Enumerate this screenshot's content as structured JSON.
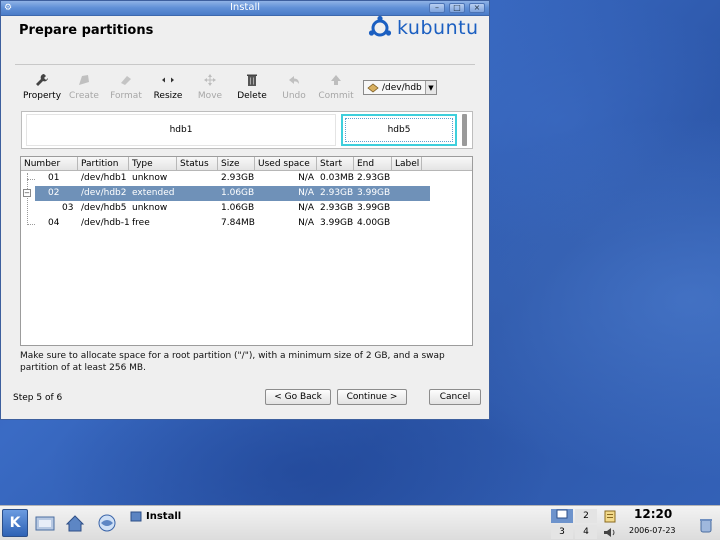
{
  "window": {
    "title": "Install",
    "page_title": "Prepare partitions",
    "logo_text": "kubuntu"
  },
  "toolbar": {
    "items": [
      {
        "label": "Property",
        "icon": "wrench-icon",
        "enabled": true
      },
      {
        "label": "Create",
        "icon": "create-icon",
        "enabled": false
      },
      {
        "label": "Format",
        "icon": "eraser-icon",
        "enabled": false
      },
      {
        "label": "Resize",
        "icon": "resize-arrows-icon",
        "enabled": true
      },
      {
        "label": "Move",
        "icon": "move-arrows-icon",
        "enabled": false
      },
      {
        "label": "Delete",
        "icon": "trash-icon",
        "enabled": true
      },
      {
        "label": "Undo",
        "icon": "undo-icon",
        "enabled": false
      },
      {
        "label": "Commit",
        "icon": "commit-icon",
        "enabled": false
      }
    ],
    "device": "/dev/hdb"
  },
  "partition_bar": {
    "segments": [
      {
        "label": "hdb1"
      },
      {
        "label": "hdb5",
        "selected": true
      }
    ]
  },
  "table": {
    "columns": [
      "Number",
      "Partition",
      "Type",
      "Status",
      "Size",
      "Used space",
      "Start",
      "End",
      "Label"
    ],
    "rows": [
      {
        "number": "01",
        "partition": "/dev/hdb1",
        "type": "unknow",
        "status": "",
        "size": "2.93GB",
        "used": "N/A",
        "start": "0.03MB",
        "end": "2.93GB",
        "label": "",
        "selected": false
      },
      {
        "number": "02",
        "partition": "/dev/hdb2",
        "type": "extended",
        "status": "",
        "size": "1.06GB",
        "used": "N/A",
        "start": "2.93GB",
        "end": "3.99GB",
        "label": "",
        "selected": true
      },
      {
        "number": "03",
        "partition": "/dev/hdb5",
        "type": "unknow",
        "status": "",
        "size": "1.06GB",
        "used": "N/A",
        "start": "2.93GB",
        "end": "3.99GB",
        "label": "",
        "selected": false
      },
      {
        "number": "04",
        "partition": "/dev/hdb-1",
        "type": "free",
        "status": "",
        "size": "7.84MB",
        "used": "N/A",
        "start": "3.99GB",
        "end": "4.00GB",
        "label": "",
        "selected": false
      }
    ]
  },
  "note": "Make sure to allocate space for a root partition (\"/\"), with a minimum size of 2 GB, and a swap partition of at least 256 MB.",
  "footer": {
    "step": "Step 5 of 6",
    "back": "< Go Back",
    "continue": "Continue >",
    "cancel": "Cancel"
  },
  "taskbar": {
    "task_label": "Install",
    "pager": [
      "2",
      "3",
      "4"
    ],
    "clock_time": "12:20",
    "clock_date": "2006-07-23"
  },
  "colors": {
    "desktop": "#3462b8",
    "selection": "#6f91b8",
    "focus": "#3ecfdc",
    "logo": "#1b5fc1"
  }
}
